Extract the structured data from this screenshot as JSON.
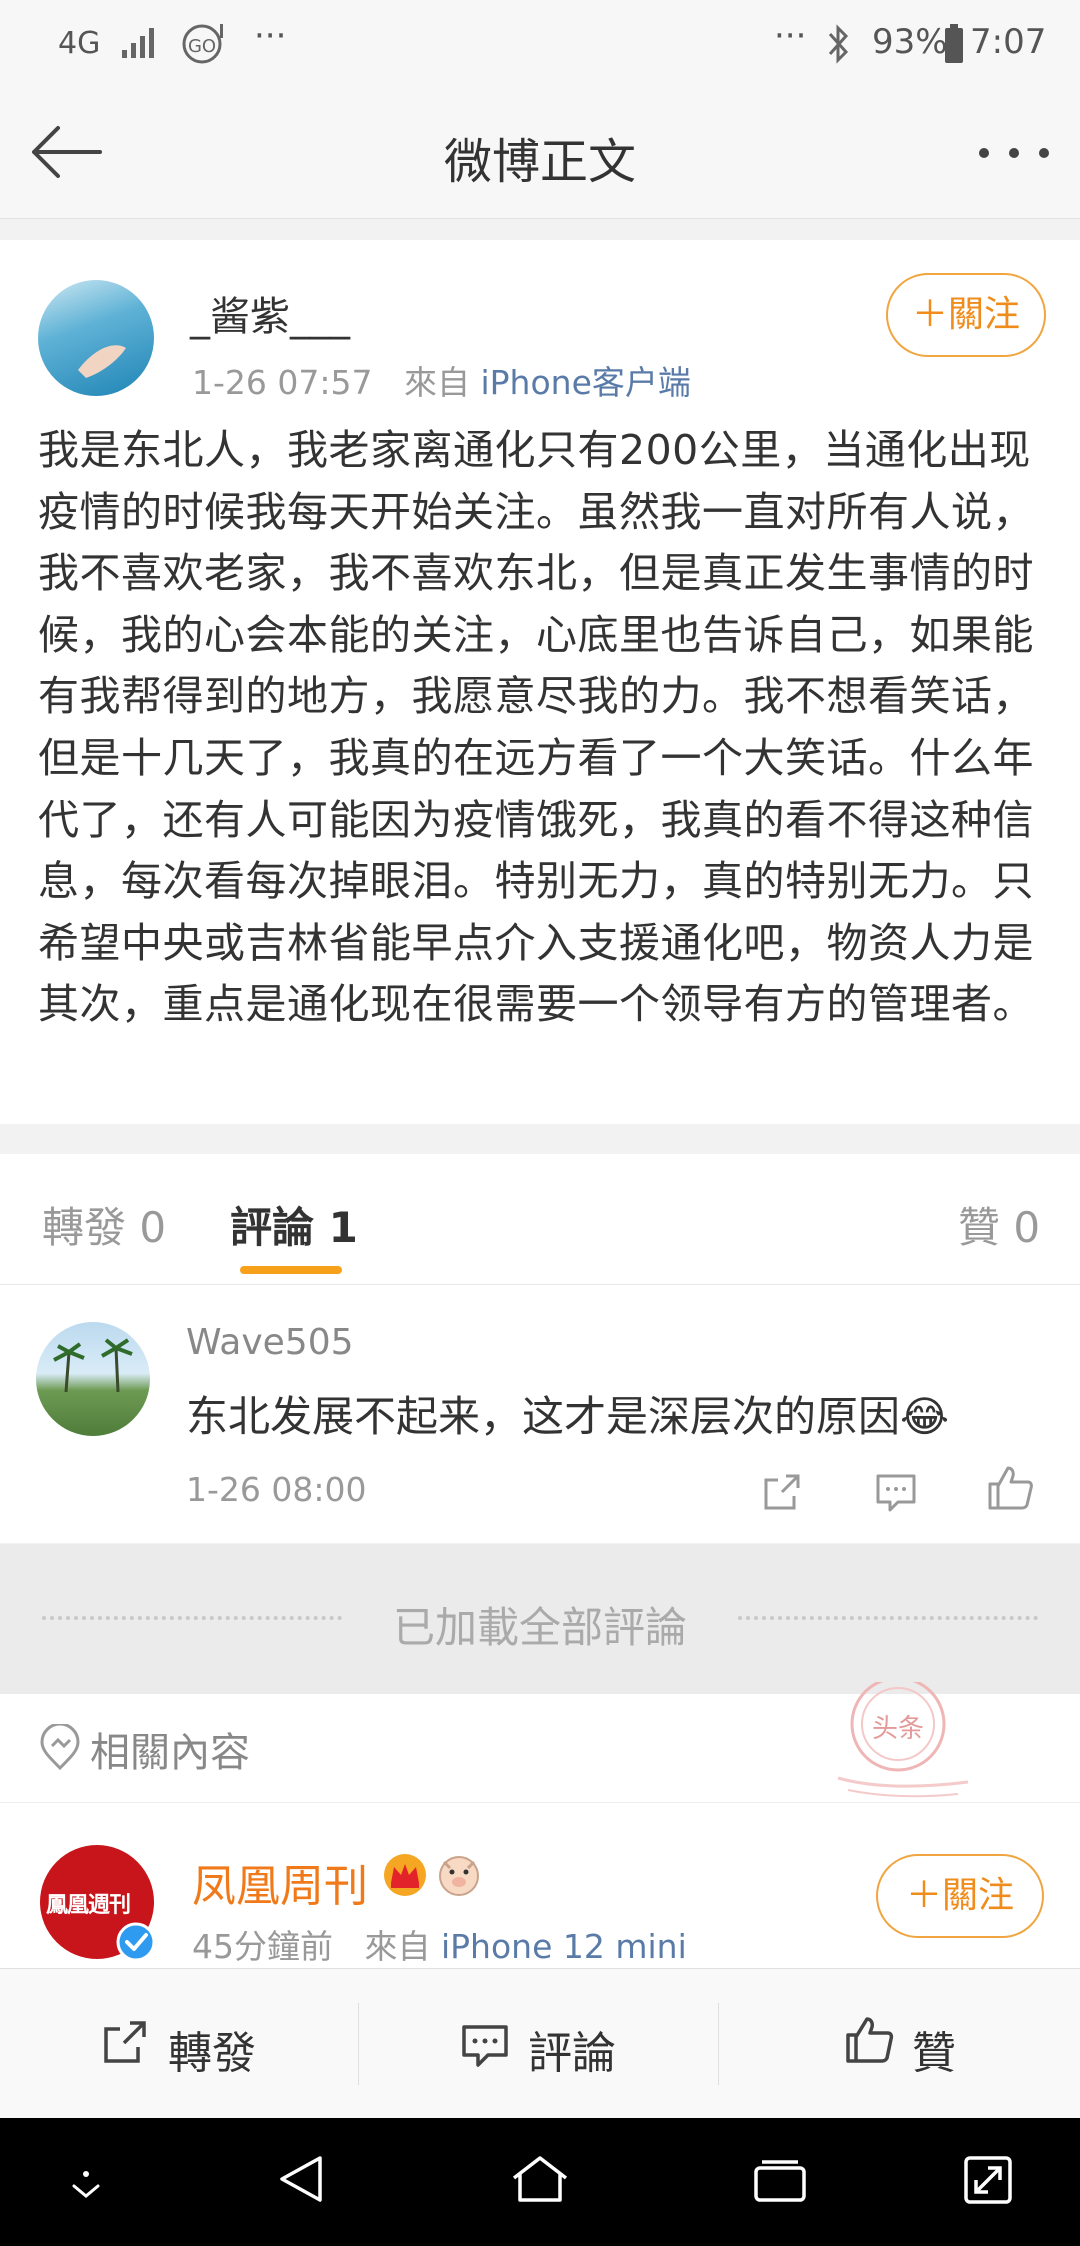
{
  "status_bar": {
    "network": "4G",
    "battery": "93%",
    "time": "7:07"
  },
  "nav": {
    "title": "微博正文"
  },
  "post": {
    "username": "_酱紫___",
    "time": "1-26 07:57",
    "source_prefix": "來自",
    "source": "iPhone客户端",
    "follow_label": "＋關注",
    "text": "我是东北人，我老家离通化只有200公里，当通化出现疫情的时候我每天开始关注。虽然我一直对所有人说，我不喜欢老家，我不喜欢东北，但是真正发生事情的时候，我的心会本能的关注，心底里也告诉自己，如果能有我帮得到的地方，我愿意尽我的力。我不想看笑话，但是十几天了，我真的在远方看了一个大笑话。什么年代了，还有人可能因为疫情饿死，我真的看不得这种信息，每次看每次掉眼泪。特别无力，真的特别无力。只希望中央或吉林省能早点介入支援通化吧，物资人力是其次，重点是通化现在很需要一个领导有方的管理者。"
  },
  "tabs": {
    "repost": "轉發 0",
    "comment": "評論 1",
    "like": "贊 0"
  },
  "comment": {
    "username": "Wave505",
    "text": "东北发展不起来，这才是深层次的原因😂",
    "time": "1-26 08:00"
  },
  "loaded_all": "已加載全部評論",
  "related": {
    "title": "相關內容",
    "watermark": "头条",
    "account": {
      "name": "凤凰周刊",
      "logo_text": "鳳凰週刊",
      "time": "45分鐘前",
      "source_prefix": "來自",
      "source": "iPhone 12 mini",
      "follow_label": "＋關注"
    }
  },
  "bottom_bar": {
    "repost": "轉發",
    "comment": "評論",
    "like": "贊"
  },
  "colors": {
    "accent_orange": "#f7a11a",
    "link_blue": "#5a7ba8"
  }
}
